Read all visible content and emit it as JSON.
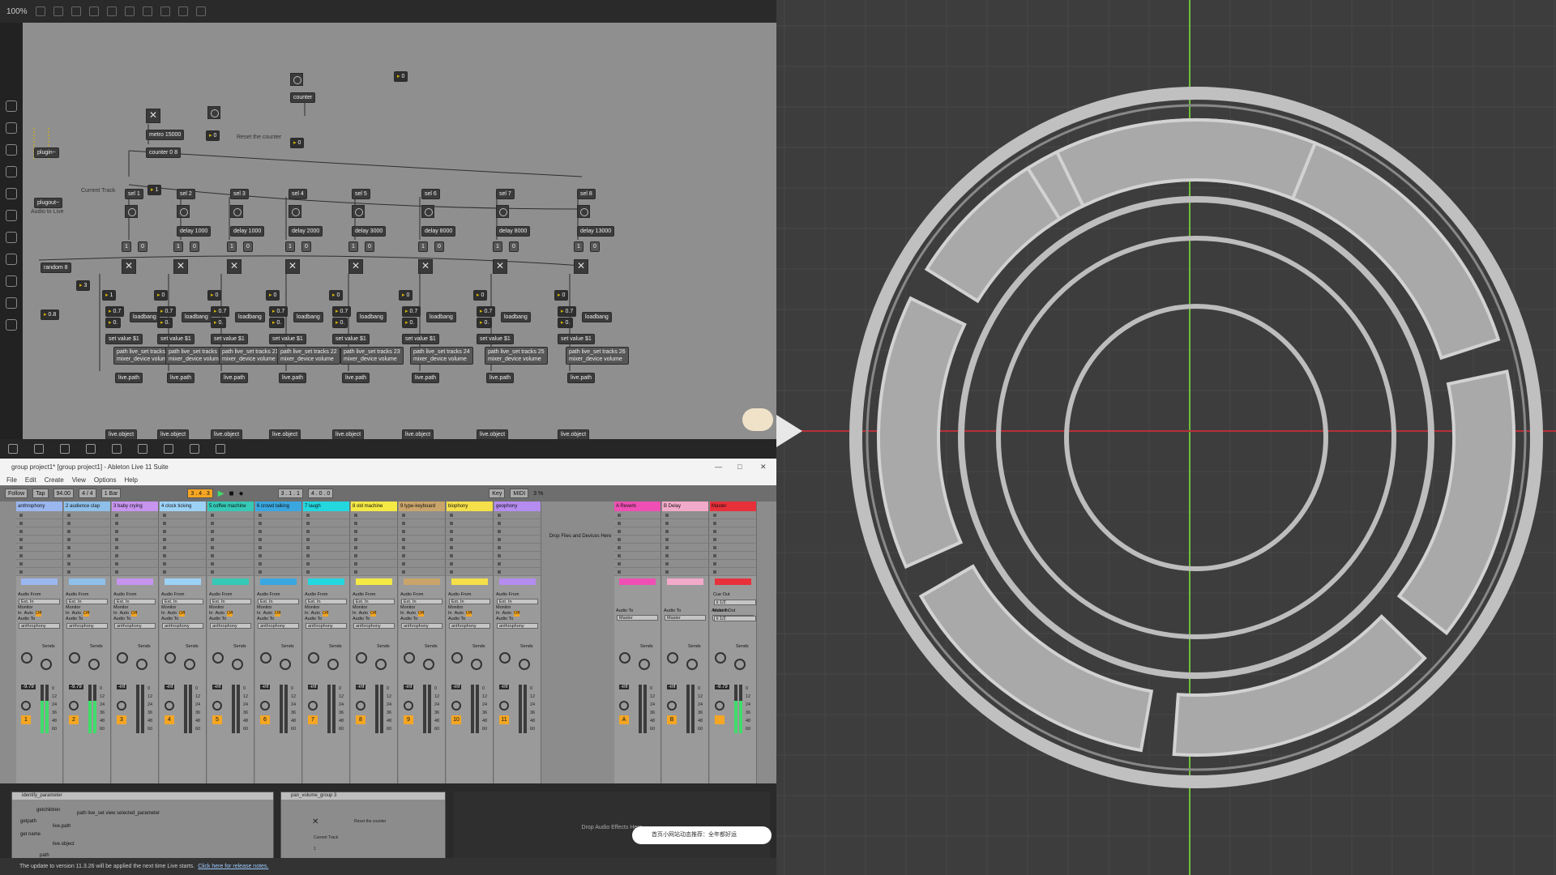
{
  "max": {
    "zoom": "100%",
    "objects": {
      "counter_top": "counter",
      "metro": "metro 15000",
      "counter_main": "counter 0 8",
      "reset_comment": "Reset the counter",
      "current_track_comment": "Current Track",
      "plugin": "plugin~",
      "plugout": "plugout~",
      "audio_comment": "Audio to Live",
      "random": "random 8",
      "num_top_right": "0",
      "num_top_left": "0",
      "num_current": "1",
      "num_random": "3",
      "num_08": "0.8",
      "set_labels": [
        "sel 1",
        "sel 2",
        "sel 3",
        "sel 4",
        "sel 5",
        "sel 6",
        "sel 7",
        "sel 8"
      ],
      "delay_labels": [
        "delay 1000",
        "delay 1000",
        "delay 2000",
        "delay 3000",
        "delay 8000",
        "delay 8000",
        "delay 13000"
      ],
      "paths": [
        "path live_set tracks 19 mixer_device volume",
        "path live_set tracks 20 mixer_device volume",
        "path live_set tracks 21 mixer_device volume",
        "path live_set tracks 22 mixer_device volume",
        "path live_set tracks 23 mixer_device volume",
        "path live_set tracks 24 mixer_device volume",
        "path live_set tracks 25 mixer_device volume",
        "path live_set tracks 26 mixer_device volume"
      ],
      "loadbang": "loadbang",
      "set_value": "set value $1",
      "live_path": "live.path",
      "live_object": "live.object"
    }
  },
  "live": {
    "title": "group project1* [group project1] - Ableton Live 11 Suite",
    "menu": [
      "File",
      "Edit",
      "Create",
      "View",
      "Options",
      "Help"
    ],
    "transport": {
      "follow": "Follow",
      "tap": "Tap",
      "tempo": "94.00",
      "signature": "4 / 4",
      "quant": "1 Bar",
      "position": "3 . 4 . 3",
      "loop_start": "3 . 1 . 1",
      "loop_len": "4 . 0 . 0",
      "key": "Key",
      "midi": "MIDI",
      "cpu": "3 %"
    },
    "tracks": [
      {
        "name": "anthrophony",
        "color": "#9bb7f0",
        "num": "1",
        "vol": "-9.79"
      },
      {
        "name": "2 audience clap",
        "color": "#8ec0ea",
        "num": "2",
        "vol": "-9.79"
      },
      {
        "name": "3 baby crying",
        "color": "#c794f0",
        "num": "3",
        "vol": "-inf"
      },
      {
        "name": "4 clock ticking",
        "color": "#9dd2f7",
        "num": "4",
        "vol": "-inf"
      },
      {
        "name": "5 coffee machine",
        "color": "#35c9b6",
        "num": "5",
        "vol": "-inf"
      },
      {
        "name": "6 crowd talking",
        "color": "#3aa7e0",
        "num": "6",
        "vol": "-inf"
      },
      {
        "name": "7 laugh",
        "color": "#23d7df",
        "num": "7",
        "vol": "-inf"
      },
      {
        "name": "8 old machine",
        "color": "#f5e944",
        "num": "8",
        "vol": "-inf"
      },
      {
        "name": "9 type-keyboard",
        "color": "#c9a46a",
        "num": "9",
        "vol": "-inf"
      },
      {
        "name": "biophony",
        "color": "#f5e04a",
        "num": "10",
        "vol": "-inf"
      },
      {
        "name": "geophony",
        "color": "#b58cf0",
        "num": "11",
        "vol": "-inf"
      }
    ],
    "returns": [
      {
        "name": "A Reverb",
        "color": "#ef4fb4",
        "num": "A",
        "vol": "-inf"
      },
      {
        "name": "B Delay",
        "color": "#f2aaca",
        "num": "B",
        "vol": "-inf"
      },
      {
        "name": "Master",
        "color": "#e8303a",
        "num": "",
        "vol": "-9.79"
      }
    ],
    "io": {
      "audio_from": "Audio From",
      "ext_in": "Ext. In",
      "monitor": "Monitor",
      "in": "In",
      "auto": "Auto",
      "off": "Off",
      "audio_to": "Audio To",
      "master": "Master",
      "dest": "anthrophony",
      "sends": "Sends",
      "cue_out": "Cue Out",
      "master_out": "Master Out",
      "cue_val": "ii 1/2"
    },
    "drop_files": "Drop Files and Devices Here",
    "drop_audio_effects": "Drop Audio Effects Here",
    "devices": [
      {
        "title": "identify_parameter",
        "lines": [
          "getchildren",
          "path live_set view selected_parameter",
          "getpath",
          "get name",
          "live.path",
          "live.object",
          "path"
        ]
      },
      {
        "title": "pan_volume_group 3",
        "lines": [
          "Reset the counter",
          "Current Track",
          "1"
        ]
      }
    ],
    "scale": [
      "0",
      "12",
      "24",
      "36",
      "48",
      "60"
    ],
    "status": "The update to version 11.3.26 will be applied the next time Live starts.",
    "status_link": "Click here for release notes.",
    "notification": "首页小网站动态推荐：全年都好运"
  },
  "colors": {
    "grid_bg": "#3d3d3d",
    "grid_line": "#474747",
    "axis_green": "#6fbf3a",
    "axis_red": "#b5303a",
    "ring": "#b9b9b9"
  }
}
